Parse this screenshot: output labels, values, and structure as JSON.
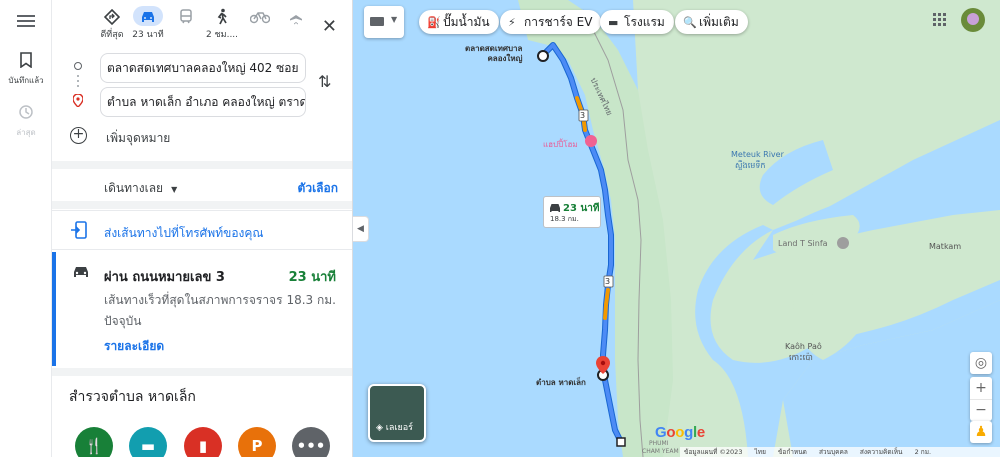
{
  "rail": {
    "saved_label": "บันทึกแล้ว",
    "recent_label": "ล่าสุด"
  },
  "modes": [
    {
      "name": "best",
      "label": "ดีที่สุด"
    },
    {
      "name": "car",
      "label": "23 นาที"
    },
    {
      "name": "transit",
      "label": ""
    },
    {
      "name": "walk",
      "label": "2 ชม...."
    },
    {
      "name": "bike",
      "label": ""
    },
    {
      "name": "flight",
      "label": ""
    }
  ],
  "origin": "ตลาดสดเทศบาลคลองใหญ่ 402 ซอย",
  "destination": "ตำบล หาดเล็ก อำเภอ คลองใหญ่ ตราด",
  "add_destination": "เพิ่มจุดหมาย",
  "depart_label": "เดินทางเลย",
  "options_label": "ตัวเลือก",
  "send_to_phone": "ส่งเส้นทางไปที่โทรศัพท์ของคุณ",
  "route": {
    "via": "ผ่าน ถนนหมายเลข 3",
    "time": "23 นาที",
    "desc": "เส้นทางเร็วที่สุดในสภาพการจราจรปัจจุบัน",
    "distance": "18.3 กม.",
    "details": "รายละเอียด"
  },
  "explore_title": "สำรวจตำบล หาดเล็ก",
  "categories": [
    {
      "name": "restaurants",
      "glyph": "🍴",
      "color": "#188038"
    },
    {
      "name": "hotels",
      "glyph": "▬",
      "color": "#129eaf"
    },
    {
      "name": "gas",
      "glyph": "▮",
      "color": "#d93025"
    },
    {
      "name": "parking",
      "glyph": "P",
      "color": "#e8710a"
    },
    {
      "name": "more",
      "glyph": "•••",
      "color": "#5f6368"
    }
  ],
  "chips": [
    {
      "name": "gas",
      "icon": "⛽",
      "label": "ปั๊มน้ำมัน"
    },
    {
      "name": "ev",
      "icon": "⚡",
      "label": "การชาร์จ EV"
    },
    {
      "name": "hotel",
      "icon": "▬",
      "label": "โรงแรม"
    },
    {
      "name": "more",
      "icon": "🔍",
      "label": "เพิ่มเติม"
    }
  ],
  "map": {
    "origin_label": "ตลาดสดเทศบาล\nคลองใหญ่",
    "dest_label": "ตำบล หาดเล็ก",
    "border_label": "ประเทศไทย",
    "poi_label": "แฮปปี้โฮม",
    "river_label": "Meteuk River",
    "river_label_km": "ស្ទឹងមេទឹក",
    "land_label": "Land T Sinfa",
    "matkam": "Matkam",
    "kaoh": "Kaôh Paô",
    "kaoh_km": "កោះប៉ោ",
    "phumi": "PHUMI",
    "cham_yeam": "CHAM YEAM",
    "callout_time": "23 นาที",
    "callout_dist": "18.3 กม.",
    "road_number": "3",
    "layers_label": "เลเยอร์",
    "google": "Google",
    "footer": [
      "ข้อมูลแผนที่ ©2023",
      "ไทย",
      "ข้อกำหนด",
      "ส่วนบุคคล",
      "ส่งความคิดเห็น",
      "2 กม."
    ],
    "colors": {
      "water": "#aadaff",
      "land": "#c8e6c9",
      "route": "#1a73e8",
      "slow": "#f29900"
    }
  }
}
